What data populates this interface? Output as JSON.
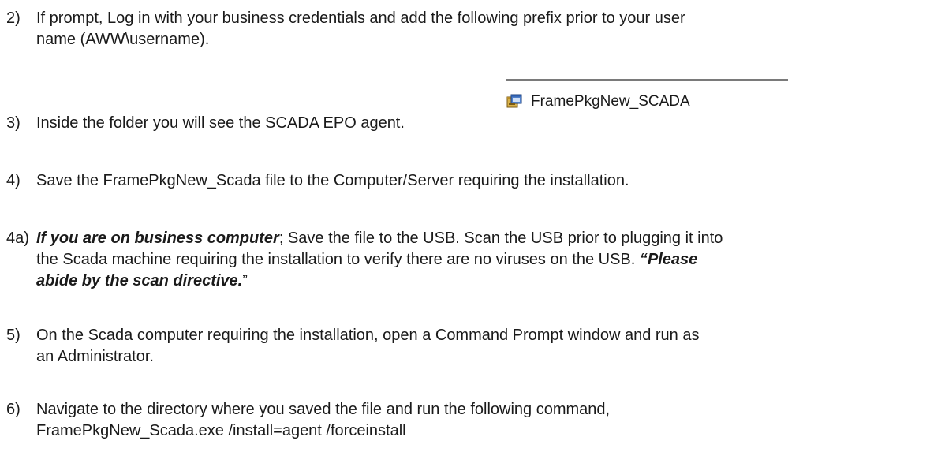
{
  "steps": [
    {
      "number": "2)",
      "lines": [
        "If prompt, Log in with your business credentials and add the following prefix prior to your user",
        "name (AWW\\username)."
      ]
    },
    {
      "number": "3)",
      "text": "Inside the folder you will see the SCADA EPO agent."
    },
    {
      "number": "4)",
      "text": "Save the FramePkgNew_Scada file to the Computer/Server requiring the installation."
    },
    {
      "number": "4a)",
      "emphasis": "If you are on business computer",
      "line1_rest": "; Save the file to the USB. Scan the USB prior to plugging it into",
      "line2": "the Scada machine requiring the installation to verify there are no viruses on the USB. ",
      "quote_bold": "“Please",
      "line3_bold": "abide by the scan directive.",
      "close_quote": "”"
    },
    {
      "number": "5)",
      "lines": [
        "On the Scada computer requiring the installation, open a Command Prompt window and run as",
        "an Administrator."
      ]
    },
    {
      "number": "6)",
      "lines": [
        "Navigate to the directory where you saved the file and run the following command,",
        "FramePkgNew_Scada.exe /install=agent /forceinstall"
      ]
    }
  ],
  "file_snippet": {
    "icon": "installer-package-icon",
    "label": "FramePkgNew_SCADA"
  }
}
